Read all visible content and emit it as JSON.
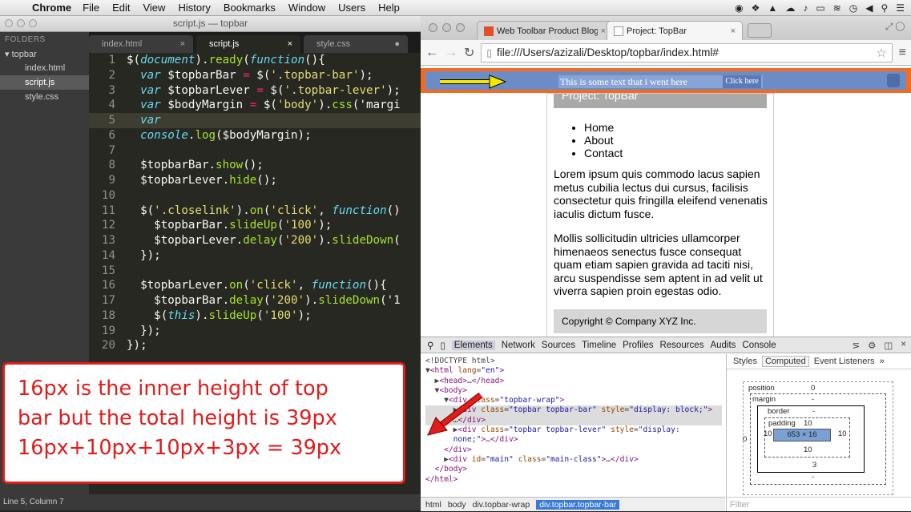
{
  "menubar": {
    "app": "Chrome",
    "items": [
      "File",
      "Edit",
      "View",
      "History",
      "Bookmarks",
      "Window",
      "Users",
      "Help"
    ]
  },
  "editor": {
    "window_title": "script.js — topbar",
    "sidebar": {
      "header": "FOLDERS",
      "folder": "topbar",
      "files": [
        "index.html",
        "script.js",
        "style.css"
      ]
    },
    "tabs": [
      "index.html",
      "script.js",
      "style.css"
    ],
    "status": "Line 5, Column 7",
    "code": [
      "$(document).ready(function(){",
      "  var $topbarBar = $('.topbar-bar');",
      "  var $topbarLever = $('.topbar-lever');",
      "  var $bodyMargin = $('body').css('margi",
      "  var",
      "  console.log($bodyMargin);",
      "",
      "  $topbarBar.show();",
      "  $topbarLever.hide();",
      "",
      "  $('.closelink').on('click', function()",
      "    $topbarBar.slideUp('100');",
      "    $topbarLever.delay('200').slideDown(",
      "  });",
      "",
      "  $topbarLever.on('click', function(){",
      "    $topbarBar.delay('200').slideDown('1",
      "    $(this).slideUp('100');",
      "  });",
      "});"
    ]
  },
  "callout": {
    "lines": [
      "16px is the inner height of top",
      "bar but the total height is 39px",
      "16px+10px+10px+3px = 39px"
    ]
  },
  "browser": {
    "tabs": [
      "Web Toolbar Product Blog",
      "Project: TopBar"
    ],
    "url": "file:///Users/azizali/Desktop/topbar/index.html#",
    "topbar_text": "This is some text that i went here",
    "topbar_link": "Click here",
    "page": {
      "header": "Project: TopBar",
      "nav": [
        "Home",
        "About",
        "Contact"
      ],
      "para1": "Lorem ipsum quis commodo lacus sapien metus cubilia lectus dui cursus, facilisis consectetur quis fringilla eleifend venenatis iaculis dictum fusce.",
      "para2": "Mollis sollicitudin ultricies ullamcorper himenaeos senectus fusce consequat quam etiam sapien gravida ad taciti nisi, arcu suspendisse sem aptent in ad velit ut viverra sapien proin egestas odio.",
      "footer": "Copyright © Company XYZ Inc."
    }
  },
  "devtools": {
    "toolbar": [
      "Elements",
      "Network",
      "Sources",
      "Timeline",
      "Profiles",
      "Resources",
      "Audits",
      "Console"
    ],
    "side_tabs": [
      "Styles",
      "Computed",
      "Event Listeners"
    ],
    "filter_placeholder": "Filter",
    "crumbs": [
      "html",
      "body",
      "div.topbar-wrap",
      "div.topbar.topbar-bar"
    ],
    "box": {
      "position_label": "position",
      "position_val": "0",
      "margin_label": "margin",
      "margin_val": "-",
      "border_label": "border",
      "border_val": "-",
      "padding_label": "padding",
      "padding_top": "10",
      "padding_bottom": "10",
      "padding_left": "10",
      "padding_right": "10",
      "content": "653 × 16",
      "border_bottom": "3",
      "margin_bottom": "-",
      "pos_left": "0"
    }
  }
}
